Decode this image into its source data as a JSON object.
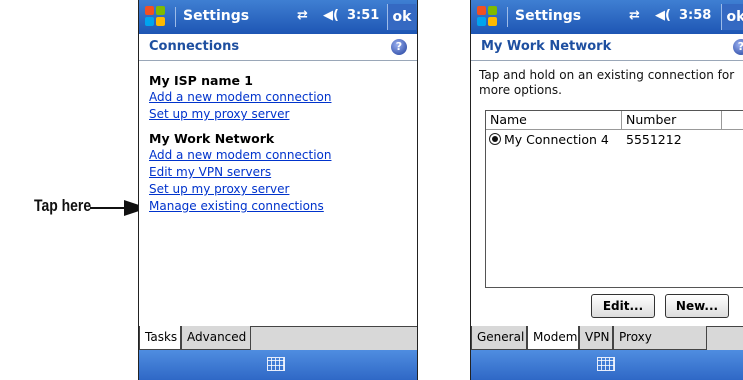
{
  "callout": {
    "label": "Tap here"
  },
  "screen1": {
    "titlebar": {
      "title": "Settings",
      "signal": "⇄",
      "volume": "◀(",
      "time": "3:51",
      "ok": "ok"
    },
    "header": "Connections",
    "help": "?",
    "groups": [
      {
        "title": "My ISP name 1",
        "links": [
          "Add a new modem connection",
          "Set up my proxy server"
        ]
      },
      {
        "title": "My Work Network",
        "links": [
          "Add a new modem connection",
          "Edit my VPN servers",
          "Set up my proxy server",
          "Manage existing connections"
        ]
      }
    ],
    "tabs": [
      "Tasks",
      "Advanced"
    ],
    "active_tab": "Tasks"
  },
  "screen2": {
    "titlebar": {
      "title": "Settings",
      "signal": "⇄",
      "volume": "◀(",
      "time": "3:58",
      "ok": "ok"
    },
    "header": "My Work Network",
    "help": "?",
    "info": "Tap and hold on an existing connection for more options.",
    "columns": [
      "Name",
      "Number"
    ],
    "rows": [
      {
        "name": "My Connection 4",
        "number": "5551212",
        "selected": true
      }
    ],
    "buttons": [
      "Edit...",
      "New..."
    ],
    "tabs": [
      "General",
      "Modem",
      "VPN",
      "Proxy Settings"
    ],
    "active_tab": "Modem"
  },
  "icons": [
    "windows-start-icon",
    "connectivity-icon",
    "volume-icon",
    "help-icon",
    "keyboard-icon",
    "arrow-icon"
  ]
}
